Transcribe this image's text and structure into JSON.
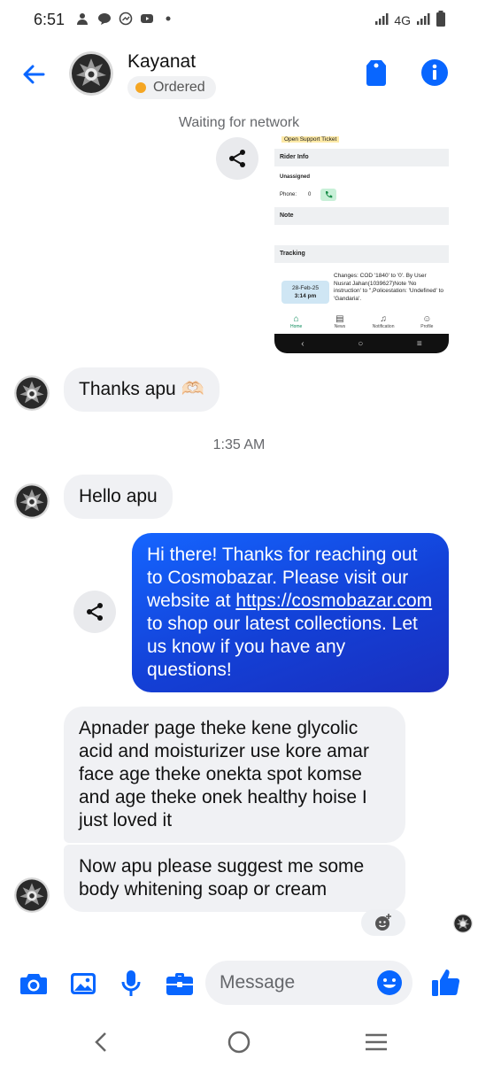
{
  "status_bar": {
    "time": "6:51",
    "network": "4G"
  },
  "header": {
    "contact_name": "Kayanat",
    "status_label": "Ordered",
    "status_color": "#f5a623"
  },
  "network_notice": "Waiting for network",
  "screenshot": {
    "support_label": "Open Support Ticket",
    "rider_info": "Rider Info",
    "unassigned": "Unassigned",
    "phone_label": "Phone:",
    "phone_value": "0",
    "note_label": "Note",
    "tracking_label": "Tracking",
    "tracking_date": "28-Feb-25",
    "tracking_time": "3:14 pm",
    "tracking_change": "Changes: COD '1840' to '0'. By User Nusrat Jahan(1039627)Note 'No instruction' to '',Policestation: 'Undefined' to 'Gandaria'.",
    "nav": [
      "Home",
      "News",
      "Notification",
      "Profile"
    ]
  },
  "messages": {
    "thanks": "Thanks apu 🫶🏻",
    "timestamp": "1:35 AM",
    "hello": "Hello apu",
    "reply_part1": "Hi there! Thanks for reaching out to Cosmobazar. Please visit our website at ",
    "reply_link": "https://cosmobazar.com",
    "reply_part2": " to shop our latest collections. Let us know if you have any questions!",
    "msg_glycolic": "Apnader page theke kene glycolic acid and moisturizer use kore amar face age theke onekta spot komse and age theke onek healthy hoise I just loved it",
    "msg_suggest": "Now apu please suggest me some body whitening soap or cream"
  },
  "composer": {
    "placeholder": "Message"
  },
  "colors": {
    "accent": "#0866ff",
    "bubble_out": "#1340d6",
    "bubble_in": "#f0f1f4"
  }
}
